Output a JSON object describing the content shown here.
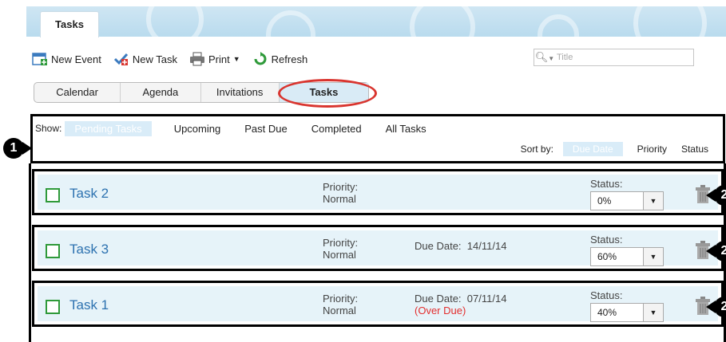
{
  "header": {
    "tab_label": "Tasks"
  },
  "toolbar": {
    "new_event": "New Event",
    "new_task": "New Task",
    "print": "Print",
    "refresh": "Refresh"
  },
  "search": {
    "placeholder": "Title"
  },
  "view_tabs": [
    {
      "label": "Calendar",
      "active": false
    },
    {
      "label": "Agenda",
      "active": false
    },
    {
      "label": "Invitations",
      "active": false
    },
    {
      "label": "Tasks",
      "active": true
    }
  ],
  "filters": {
    "show_label": "Show:",
    "items": [
      "Pending Tasks",
      "Upcoming",
      "Past Due",
      "Completed",
      "All Tasks"
    ],
    "active": "Pending Tasks"
  },
  "sort": {
    "label": "Sort by:",
    "items": [
      "Due Date",
      "Priority",
      "Status"
    ],
    "active": "Due Date"
  },
  "annotations": {
    "one": "1",
    "two": "2"
  },
  "tasks": [
    {
      "title": "Task 2",
      "priority_label": "Priority:",
      "priority": "Normal",
      "due_label": "",
      "due_date": "",
      "overdue": "",
      "status_label": "Status:",
      "status": "0%"
    },
    {
      "title": "Task 3",
      "priority_label": "Priority:",
      "priority": "Normal",
      "due_label": "Due Date:",
      "due_date": "14/11/14",
      "overdue": "",
      "status_label": "Status:",
      "status": "60%"
    },
    {
      "title": "Task 1",
      "priority_label": "Priority:",
      "priority": "Normal",
      "due_label": "Due Date:",
      "due_date": "07/11/14",
      "overdue": "(Over Due)",
      "status_label": "Status:",
      "status": "40%"
    }
  ],
  "colors": {
    "accent": "#2d72b0",
    "highlight_circle": "#d9352f",
    "checkbox": "#2f9a3a",
    "overdue": "#e32e2e",
    "row_bg": "#e6f3f9"
  }
}
